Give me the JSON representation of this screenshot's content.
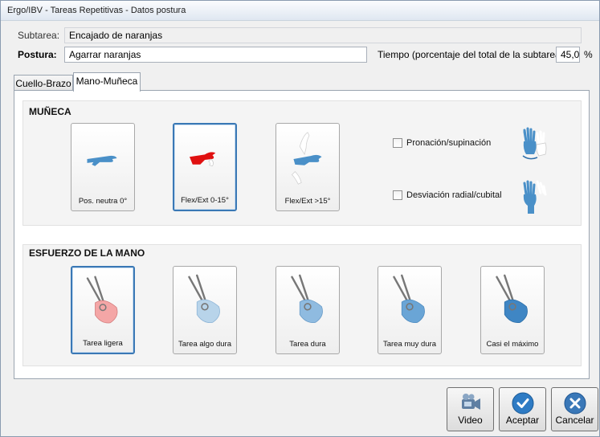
{
  "window": {
    "title": "Ergo/IBV - Tareas Repetitivas - Datos postura"
  },
  "form": {
    "subtarea_label": "Subtarea:",
    "subtarea_value": "Encajado de naranjas",
    "postura_label": "Postura:",
    "postura_value": "Agarrar naranjas",
    "tiempo_label": "Tiempo (porcentaje del total de la subtarea):",
    "tiempo_value": "45,0",
    "tiempo_unit": "%"
  },
  "tabs": [
    {
      "label": "Cuello-Brazo",
      "active": false
    },
    {
      "label": "Mano-Muñeca",
      "active": true
    }
  ],
  "muneca": {
    "title": "MUÑECA",
    "options": [
      {
        "label": "Pos. neutra 0°",
        "selected": false
      },
      {
        "label": "Flex/Ext 0-15°",
        "selected": true
      },
      {
        "label": "Flex/Ext >15°",
        "selected": false
      }
    ],
    "checks": [
      {
        "label": "Pronación/supinación",
        "checked": false
      },
      {
        "label": "Desviación radial/cubital",
        "checked": false
      }
    ]
  },
  "esfuerzo": {
    "title": "ESFUERZO DE LA MANO",
    "options": [
      {
        "label": "Tarea ligera",
        "selected": true
      },
      {
        "label": "Tarea algo dura",
        "selected": false
      },
      {
        "label": "Tarea dura",
        "selected": false
      },
      {
        "label": "Tarea muy dura",
        "selected": false
      },
      {
        "label": "Casi el máximo",
        "selected": false
      }
    ]
  },
  "buttons": {
    "video": "Video",
    "accept": "Aceptar",
    "cancel": "Cancelar"
  },
  "colors": {
    "hand_blue": "#4a90c8",
    "hand_red": "#e01010",
    "select_border": "#3a78b5",
    "accept_blue": "#2e7bc4",
    "cancel_blue": "#3a78b8"
  }
}
